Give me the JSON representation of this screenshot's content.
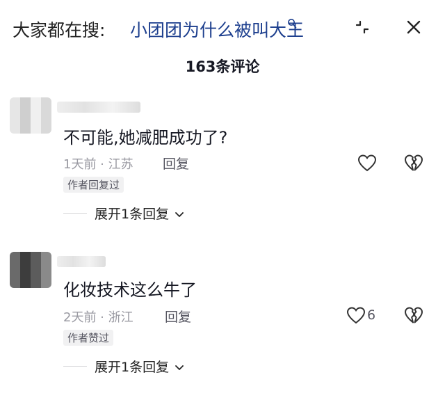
{
  "header": {
    "search_prefix": "大家都在搜:",
    "search_query": "小团团为什么被叫大王"
  },
  "comment_count": "163条评论",
  "comments": [
    {
      "text": "不可能,她减肥成功了?",
      "time_location": "1天前 · 江苏",
      "reply_label": "回复",
      "author_tag": "作者回复过",
      "like_count": "",
      "expand_label": "展开1条回复"
    },
    {
      "text": "化妆技术这么牛了",
      "time_location": "2天前 · 浙江",
      "reply_label": "回复",
      "author_tag": "作者赞过",
      "like_count": "6",
      "expand_label": "展开1条回复"
    }
  ],
  "icons": {
    "collapse": "collapse-icon",
    "close": "close-icon",
    "like": "heart-outline-icon",
    "dislike": "broken-heart-icon",
    "chevron": "chevron-down-icon"
  }
}
